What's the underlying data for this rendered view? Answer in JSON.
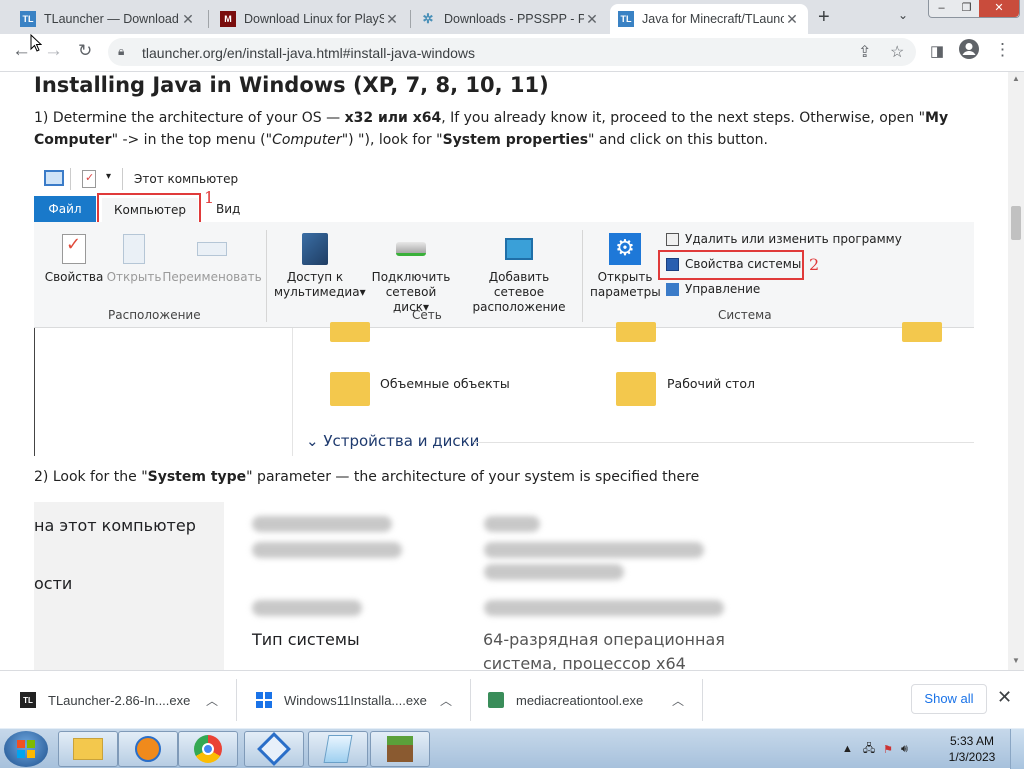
{
  "browser": {
    "tabs": [
      {
        "title": "TLauncher — Download Mi",
        "favicon": "tl-icon",
        "active": false
      },
      {
        "title": "Download Linux for PlayS",
        "favicon": "playstation-icon",
        "active": false
      },
      {
        "title": "Downloads - PPSSPP - PS",
        "favicon": "ppsspp-icon",
        "active": false
      },
      {
        "title": "Java for Minecraft/TLaunc",
        "favicon": "tl-icon",
        "active": true
      }
    ],
    "new_tab_glyph": "+",
    "url": "tlauncher.org/en/install-java.html#install-java-windows"
  },
  "page": {
    "heading": "Installing Java in Windows (XP, 7, 8, 10, 11)",
    "step1": {
      "t1": "1) Determine the architecture of your OS — ",
      "b1": "x32 или x64",
      "t2": ", If you already know it, proceed to the next steps. Otherwise, open \"",
      "b2": "My Computer",
      "t3": "\" -> in the top menu (\"",
      "i1": "Computer",
      "t4": "\") \"), look for \"",
      "b3": "System properties",
      "t5": "\" and click on this button."
    },
    "step2": {
      "t1": "2) Look for the \"",
      "b1": "System type",
      "t2": "\" parameter — the architecture of your system is specified there"
    },
    "explorer_shot": {
      "qat_title": "Этот компьютер",
      "tab_file": "Файл",
      "tab_computer": "Компьютер",
      "tab_view": "Вид",
      "marker1": "1",
      "marker2": "2",
      "btn_properties": "Свойства",
      "btn_open": "Открыть",
      "btn_rename": "Переименовать",
      "group_location": "Расположение",
      "btn_media_1": "Доступ к",
      "btn_media_2": "мультимедиа",
      "btn_netdisk_1": "Подключить",
      "btn_netdisk_2": "сетевой диск",
      "btn_netloc_1": "Добавить сетевое",
      "btn_netloc_2": "расположение",
      "group_network": "Сеть",
      "btn_settings_1": "Открыть",
      "btn_settings_2": "параметры",
      "item_uninstall": "Удалить или изменить программу",
      "item_sysprops": "Свойства системы",
      "item_manage": "Управление",
      "group_system": "Система",
      "folder_3d": "Объемные объекты",
      "folder_desktop": "Рабочий стол",
      "section_devices": "Устройства и диски"
    },
    "sysinfo_shot": {
      "left_1": "на этот компьютер",
      "left_2": "ости",
      "label_type": "Тип системы",
      "value_type_1": "64-разрядная операционная",
      "value_type_2": "система, процессор x64"
    }
  },
  "downloads": {
    "items": [
      {
        "name": "TLauncher-2.86-In....exe",
        "icon": "tl-icon"
      },
      {
        "name": "Windows11Installa....exe",
        "icon": "windows-icon"
      },
      {
        "name": "mediacreationtool.exe",
        "icon": "installer-icon"
      }
    ],
    "show_all": "Show all"
  },
  "taskbar": {
    "apps": [
      "file-explorer-icon",
      "media-player-icon",
      "chrome-icon",
      "network-app-icon",
      "notepad-icon",
      "minecraft-icon"
    ],
    "time": "5:33 AM",
    "date": "1/3/2023"
  },
  "colors": {
    "annotation_red": "#e03a3a",
    "link_blue": "#1a73e8",
    "ribbon_file_blue": "#1979ca"
  }
}
